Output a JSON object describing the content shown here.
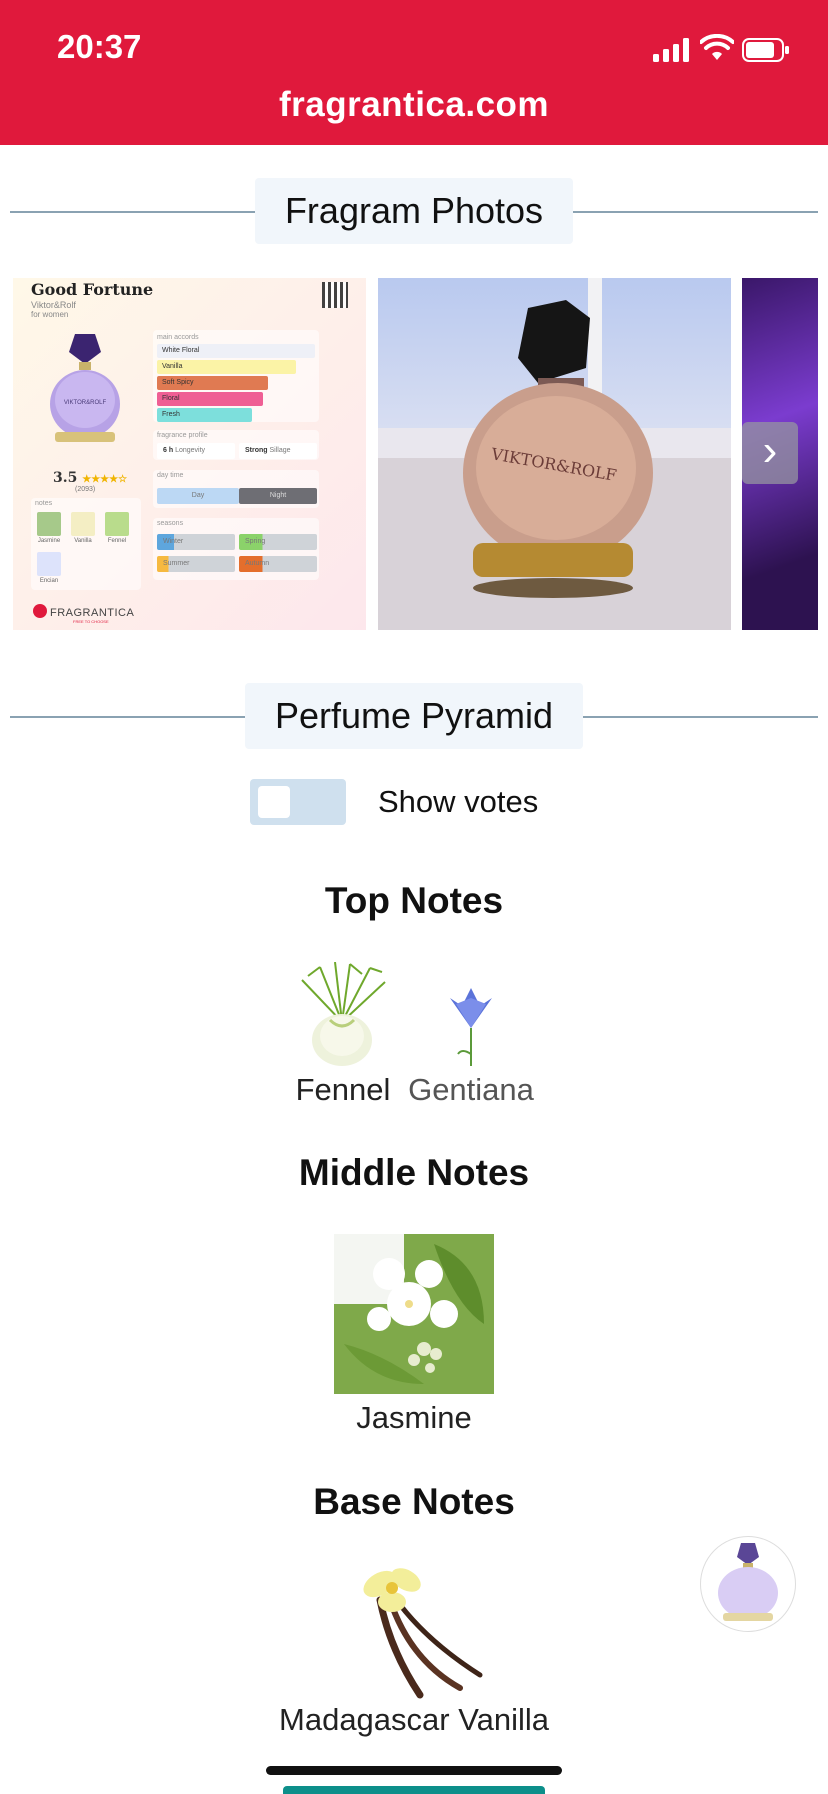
{
  "status_bar": {
    "time": "20:37",
    "url": "fragrantica.com",
    "accent_color": "#e0193c"
  },
  "photos_section": {
    "title": "Fragram Photos",
    "card": {
      "perfume_name": "Good Fortune",
      "brand": "Viktor&Rolf",
      "gender": "for women",
      "bottle_text": "VIKTOR&ROLF",
      "rating": "3.5",
      "votes": "(2093)",
      "main_accords_label": "main accords",
      "accords": [
        {
          "name": "White Floral",
          "color": "#eef0f7",
          "level": 1.0
        },
        {
          "name": "Vanilla",
          "color": "#fbf3a6",
          "level": 0.88
        },
        {
          "name": "Soft Spicy",
          "color": "#e07a52",
          "level": 0.7
        },
        {
          "name": "Floral",
          "color": "#ef5f94",
          "level": 0.67
        },
        {
          "name": "Fresh",
          "color": "#7ddfdc",
          "level": 0.6
        }
      ],
      "profile_label": "fragrance profile",
      "longevity_value": "6 h",
      "longevity_label": "Longevity",
      "sillage_value": "Strong",
      "sillage_label": "Sillage",
      "daytime_label": "day time",
      "day_label": "Day",
      "night_label": "Night",
      "seasons_label": "seasons",
      "seasons": [
        {
          "name": "Winter",
          "color": "#5ea6dd",
          "level": 0.22
        },
        {
          "name": "Spring",
          "color": "#8bd26a",
          "level": 0.3
        },
        {
          "name": "Summer",
          "color": "#f6b940",
          "level": 0.15
        },
        {
          "name": "Autumn",
          "color": "#e46e2c",
          "level": 0.3
        }
      ],
      "notes_label": "notes",
      "notes": [
        "Jasmine",
        "Vanilla",
        "Fennel",
        "Encian"
      ],
      "footer_brand": "FRAGRANTICA",
      "footer_tag": "FREE TO CHOOSE"
    },
    "photo2_bottle_text": "VIKTOR&ROLF"
  },
  "pyramid_section": {
    "title": "Perfume Pyramid",
    "toggle_label": "Show votes",
    "toggle_on": false,
    "top_notes": {
      "heading": "Top Notes",
      "items": [
        "Fennel",
        "Gentiana"
      ]
    },
    "middle_notes": {
      "heading": "Middle Notes",
      "items": [
        "Jasmine"
      ]
    },
    "base_notes": {
      "heading": "Base Notes",
      "items": [
        "Madagascar Vanilla"
      ]
    }
  }
}
